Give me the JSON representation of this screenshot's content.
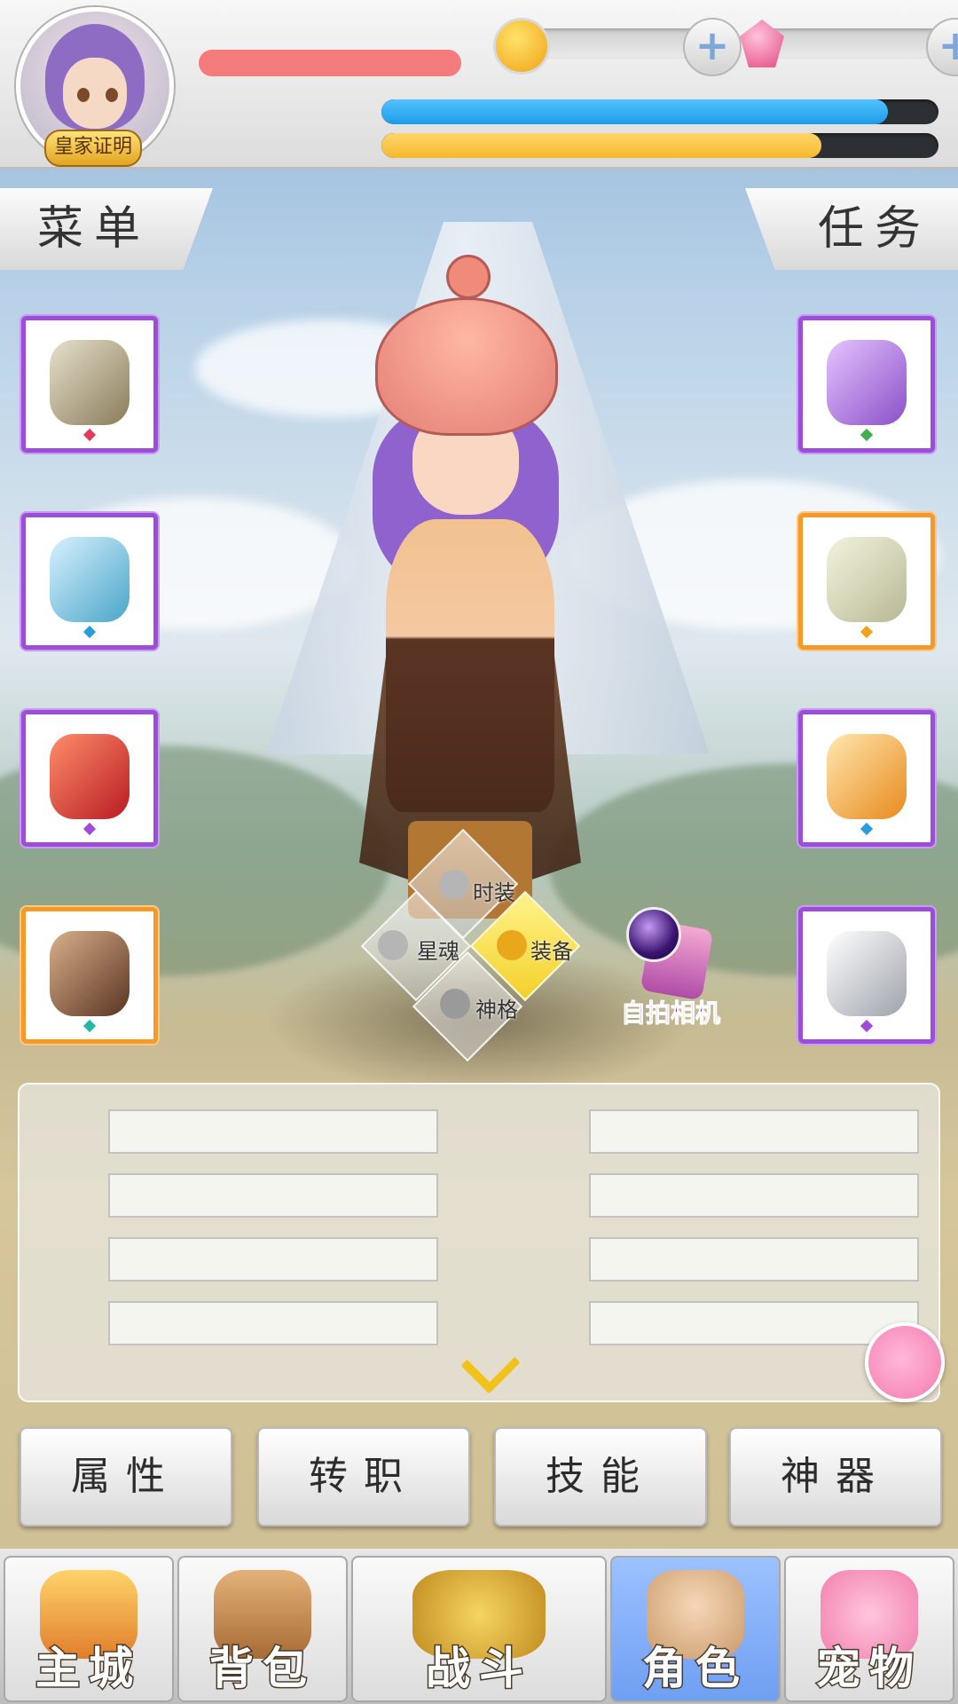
{
  "header": {
    "badge_label": "皇家证明",
    "hp_fill": 0.91,
    "exp_fill": 0.79,
    "currencies": [
      {
        "icon": "gold-coin-icon",
        "value": ""
      },
      {
        "icon": "pink-gem-icon",
        "value": ""
      }
    ]
  },
  "side_tabs": {
    "menu_label": "菜单",
    "task_label": "任务"
  },
  "equipment": {
    "left": [
      {
        "icon": "headgear-icon",
        "rarity": "purple",
        "gem": "#e43a5a"
      },
      {
        "icon": "staff-icon",
        "rarity": "purple",
        "gem": "#2b9be0"
      },
      {
        "icon": "cape-icon",
        "rarity": "purple",
        "gem": "#a24bd8"
      },
      {
        "icon": "gauntlet-icon",
        "rarity": "orange",
        "gem": "#22b7a6"
      }
    ],
    "right": [
      {
        "icon": "robe-icon",
        "rarity": "purple",
        "gem": "#3fb04d"
      },
      {
        "icon": "scroll-icon",
        "rarity": "orange",
        "gem": "#f0a21c"
      },
      {
        "icon": "boots-icon",
        "rarity": "purple",
        "gem": "#2b9be0"
      },
      {
        "icon": "ring-icon",
        "rarity": "purple",
        "gem": "#a24bd8"
      }
    ]
  },
  "diamond_menu": {
    "fashion": "时装",
    "star_soul": "星魂",
    "equipment": "装备",
    "divinity": "神格"
  },
  "camera_label": "自拍相机",
  "function_buttons": [
    "属性",
    "转职",
    "技能",
    "神器"
  ],
  "bottom_nav": [
    {
      "label": "主城",
      "icon": "castle-icon",
      "active": false
    },
    {
      "label": "背包",
      "icon": "backpack-icon",
      "active": false
    },
    {
      "label": "战斗",
      "icon": "battle-icon",
      "active": false
    },
    {
      "label": "角色",
      "icon": "character-icon",
      "active": true
    },
    {
      "label": "宠物",
      "icon": "pet-icon",
      "active": false
    }
  ],
  "colors": {
    "hp": "#1e9be6",
    "exp": "#f5b92c",
    "name_bar": "#f47b7b",
    "active_nav": "#7aa8f5"
  }
}
